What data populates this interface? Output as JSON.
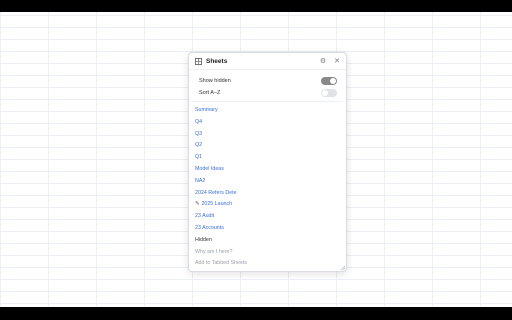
{
  "panel": {
    "title": "Sheets",
    "icons": {
      "grid": "grid-icon",
      "settings": "gear-icon",
      "close": "close-icon"
    },
    "close_glyph": "✕",
    "settings_glyph": "⚙"
  },
  "toggles": [
    {
      "label": "Show hidden",
      "state": "on"
    },
    {
      "label": "Sort A–Z",
      "state": "off"
    }
  ],
  "sheets": [
    {
      "label": "Summary"
    },
    {
      "label": "Q4"
    },
    {
      "label": "Q3"
    },
    {
      "label": "Q2"
    },
    {
      "label": "Q1"
    },
    {
      "label": "Model Ideas"
    },
    {
      "label": "NA2"
    },
    {
      "label": "2024 Refers Dete"
    },
    {
      "label": "2025 Launch",
      "icon": "pencil-icon",
      "glyph": "✎"
    },
    {
      "label": "23 Audit"
    },
    {
      "label": "23 Accounts"
    }
  ],
  "hidden_section": {
    "label": "Hidden",
    "items": [
      {
        "label": "Why am I here?"
      },
      {
        "label": "Add to Tabbed Sheets"
      }
    ]
  },
  "colors": {
    "link": "#3b6fd6",
    "toggle_on": "#888888",
    "toggle_off": "#dfe2e6",
    "hidden_text": "#9aa0a8"
  }
}
